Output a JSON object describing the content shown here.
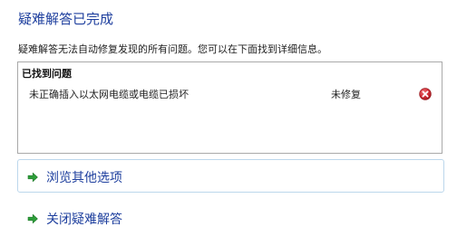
{
  "header": {
    "title": "疑难解答已完成",
    "subtitle": "疑难解答无法自动修复发现的所有问题。您可以在下面找到详细信息。"
  },
  "problems": {
    "header": "已找到问题",
    "items": [
      {
        "description": "未正确插入以太网电缆或电缆已损坏",
        "status": "未修复",
        "status_icon": "error-icon"
      }
    ]
  },
  "actions": {
    "browse_options": "浏览其他选项",
    "close_troubleshooter": "关闭疑难解答"
  },
  "colors": {
    "title": "#1e3f9e",
    "link": "#1e3f9e",
    "option_border": "#bcd7ec",
    "box_border": "#a9a9a9",
    "arrow_green": "#2e9e3a",
    "error_red": "#c8262e"
  }
}
